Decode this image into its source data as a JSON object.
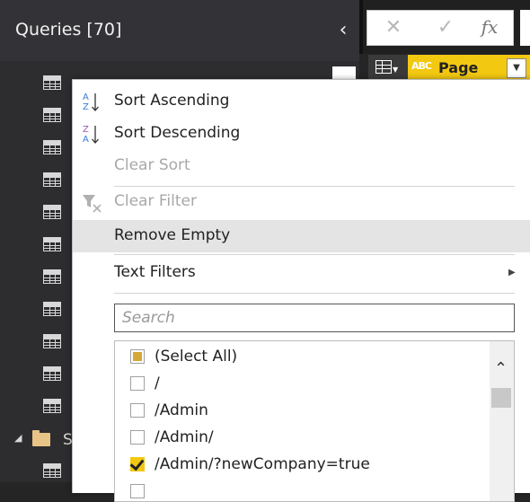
{
  "queries_pane": {
    "title": "Queries [70]",
    "collapse_glyph": "‹",
    "partial_query_name": "",
    "group_initial": "S",
    "icons": {
      "table": "table-icon",
      "folder": "folder-icon",
      "expand": "triangle-down-icon"
    }
  },
  "formula_bar": {
    "cancel_glyph": "✕",
    "confirm_glyph": "✓",
    "fx_label": "fx"
  },
  "column_header": {
    "type_badge": "ABC",
    "name": "Page"
  },
  "menu": {
    "sort_ascending": "Sort Ascending",
    "sort_descending": "Sort Descending",
    "clear_sort": "Clear Sort",
    "clear_filter": "Clear Filter",
    "remove_empty": "Remove Empty",
    "text_filters": "Text Filters",
    "search_placeholder": "Search",
    "values": [
      {
        "label": "(Select All)",
        "state": "partial"
      },
      {
        "label": "/",
        "state": "unchecked"
      },
      {
        "label": "/Admin",
        "state": "unchecked"
      },
      {
        "label": "/Admin/",
        "state": "unchecked"
      },
      {
        "label": "/Admin/?newCompany=true",
        "state": "checked"
      }
    ]
  },
  "colors": {
    "accent_yellow": "#f2c811",
    "pane_background": "#2d2d30",
    "menu_hover": "#e4e4e4"
  }
}
